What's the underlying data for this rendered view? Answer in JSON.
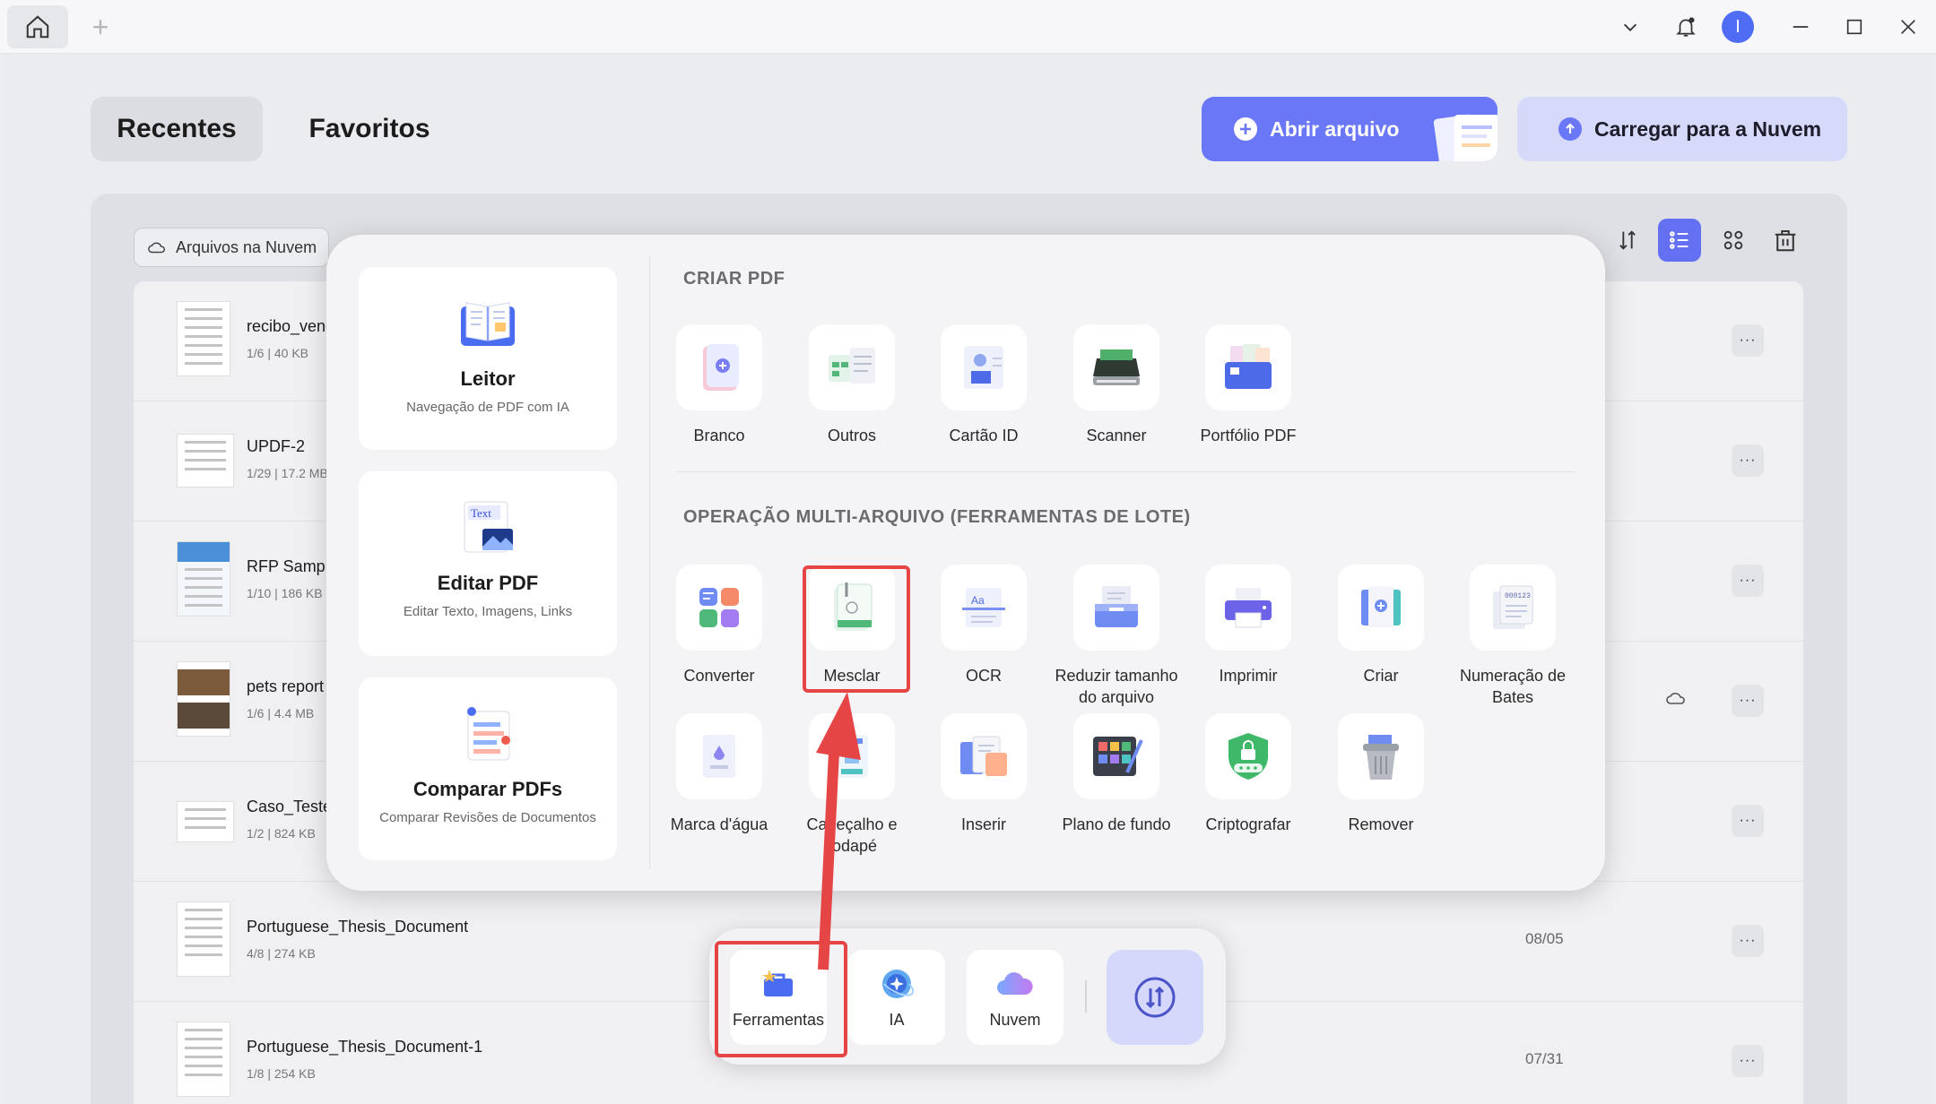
{
  "window": {
    "new_tab_label": "+",
    "avatar_initial": "I"
  },
  "tabs": {
    "recentes": "Recentes",
    "favoritos": "Favoritos"
  },
  "actions": {
    "open_file": "Abrir arquivo",
    "upload_cloud": "Carregar para a Nuvem"
  },
  "toolbar": {
    "cloud_files": "Arquivos na Nuvem"
  },
  "files": [
    {
      "name": "recibo_vend",
      "meta": "1/6 | 40 KB",
      "date": ""
    },
    {
      "name": "UPDF-2",
      "meta": "1/29 | 17.2 MB",
      "date": ""
    },
    {
      "name": "RFP Sample",
      "meta": "1/10 | 186 KB",
      "date": ""
    },
    {
      "name": "pets report",
      "meta": "1/6 | 4.4 MB",
      "date": ""
    },
    {
      "name": "Caso_Teste_",
      "meta": "1/2 | 824 KB",
      "date": ""
    },
    {
      "name": "Portuguese_Thesis_Document",
      "meta": "4/8 | 274 KB",
      "date": "08/05"
    },
    {
      "name": "Portuguese_Thesis_Document-1",
      "meta": "1/8 | 254 KB",
      "date": "07/31"
    }
  ],
  "more_label": "···",
  "side_cards": [
    {
      "title": "Leitor",
      "desc": "Navegação de PDF com IA"
    },
    {
      "title": "Editar PDF",
      "desc": "Editar Texto, Imagens, Links"
    },
    {
      "title": "Comparar PDFs",
      "desc": "Comparar Revisões de Documentos"
    }
  ],
  "sections": {
    "create": "CRIAR PDF",
    "batch": "OPERAÇÃO MULTI-ARQUIVO (FERRAMENTAS DE LOTE)"
  },
  "create_tools": [
    "Branco",
    "Outros",
    "Cartão ID",
    "Scanner",
    "Portfólio PDF"
  ],
  "batch_tools": [
    "Converter",
    "Mesclar",
    "OCR",
    "Reduzir tamanho do arquivo",
    "Imprimir",
    "Criar",
    "Numeração de Bates",
    "Marca d'água",
    "Cabeçalho e rodapé",
    "Inserir",
    "Plano de fundo",
    "Criptografar",
    "Remover"
  ],
  "dock": {
    "tools": "Ferramentas",
    "ai": "IA",
    "cloud": "Nuvem"
  },
  "colors": {
    "accent": "#6a78f7",
    "highlight": "#e54545"
  }
}
